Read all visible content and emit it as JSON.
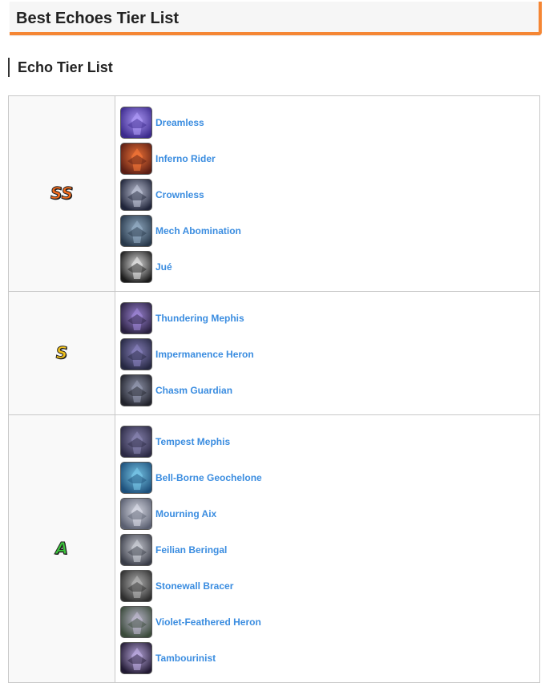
{
  "header": {
    "title": "Best Echoes Tier List"
  },
  "section": {
    "title": "Echo Tier List"
  },
  "tiers": [
    {
      "label": "SS",
      "color": "#f26a1b",
      "echoes": [
        {
          "name": "Dreamless",
          "icon": "dreamless-icon",
          "bg": "#3b2a8c",
          "fg": "#b7a2ff"
        },
        {
          "name": "Inferno Rider",
          "icon": "inferno-rider-icon",
          "bg": "#5a1e14",
          "fg": "#ff7b3a"
        },
        {
          "name": "Crownless",
          "icon": "crownless-icon",
          "bg": "#20253a",
          "fg": "#c9cde0"
        },
        {
          "name": "Mech Abomination",
          "icon": "mech-abomination-icon",
          "bg": "#28384a",
          "fg": "#9ab4cc"
        },
        {
          "name": "Jué",
          "icon": "jue-icon",
          "bg": "#1b1b1b",
          "fg": "#f1f1f1"
        }
      ]
    },
    {
      "label": "S",
      "color": "#f2c21b",
      "echoes": [
        {
          "name": "Thundering Mephis",
          "icon": "thundering-mephis-icon",
          "bg": "#2a2140",
          "fg": "#a58ce0"
        },
        {
          "name": "Impermanence Heron",
          "icon": "impermanence-heron-icon",
          "bg": "#262842",
          "fg": "#8e86c4"
        },
        {
          "name": "Chasm Guardian",
          "icon": "chasm-guardian-icon",
          "bg": "#22232c",
          "fg": "#9aa0b8"
        }
      ]
    },
    {
      "label": "A",
      "color": "#3cc43c",
      "echoes": [
        {
          "name": "Tempest Mephis",
          "icon": "tempest-mephis-icon",
          "bg": "#2c2a44",
          "fg": "#8e8ab8"
        },
        {
          "name": "Bell-Borne Geochelone",
          "icon": "bell-borne-geochelone-icon",
          "bg": "#1d4f7a",
          "fg": "#7fd0f0"
        },
        {
          "name": "Mourning Aix",
          "icon": "mourning-aix-icon",
          "bg": "#5a5f70",
          "fg": "#e2e4ee"
        },
        {
          "name": "Feilian Beringal",
          "icon": "feilian-beringal-icon",
          "bg": "#3a3d48",
          "fg": "#d6d8e0"
        },
        {
          "name": "Stonewall Bracer",
          "icon": "stonewall-bracer-icon",
          "bg": "#2e2e2e",
          "fg": "#bdbdbd"
        },
        {
          "name": "Violet-Feathered Heron",
          "icon": "violet-feathered-heron-icon",
          "bg": "#3a4a3a",
          "fg": "#c6c0d8"
        },
        {
          "name": "Tambourinist",
          "icon": "tambourinist-icon",
          "bg": "#221a33",
          "fg": "#c8b6ee"
        }
      ]
    }
  ]
}
